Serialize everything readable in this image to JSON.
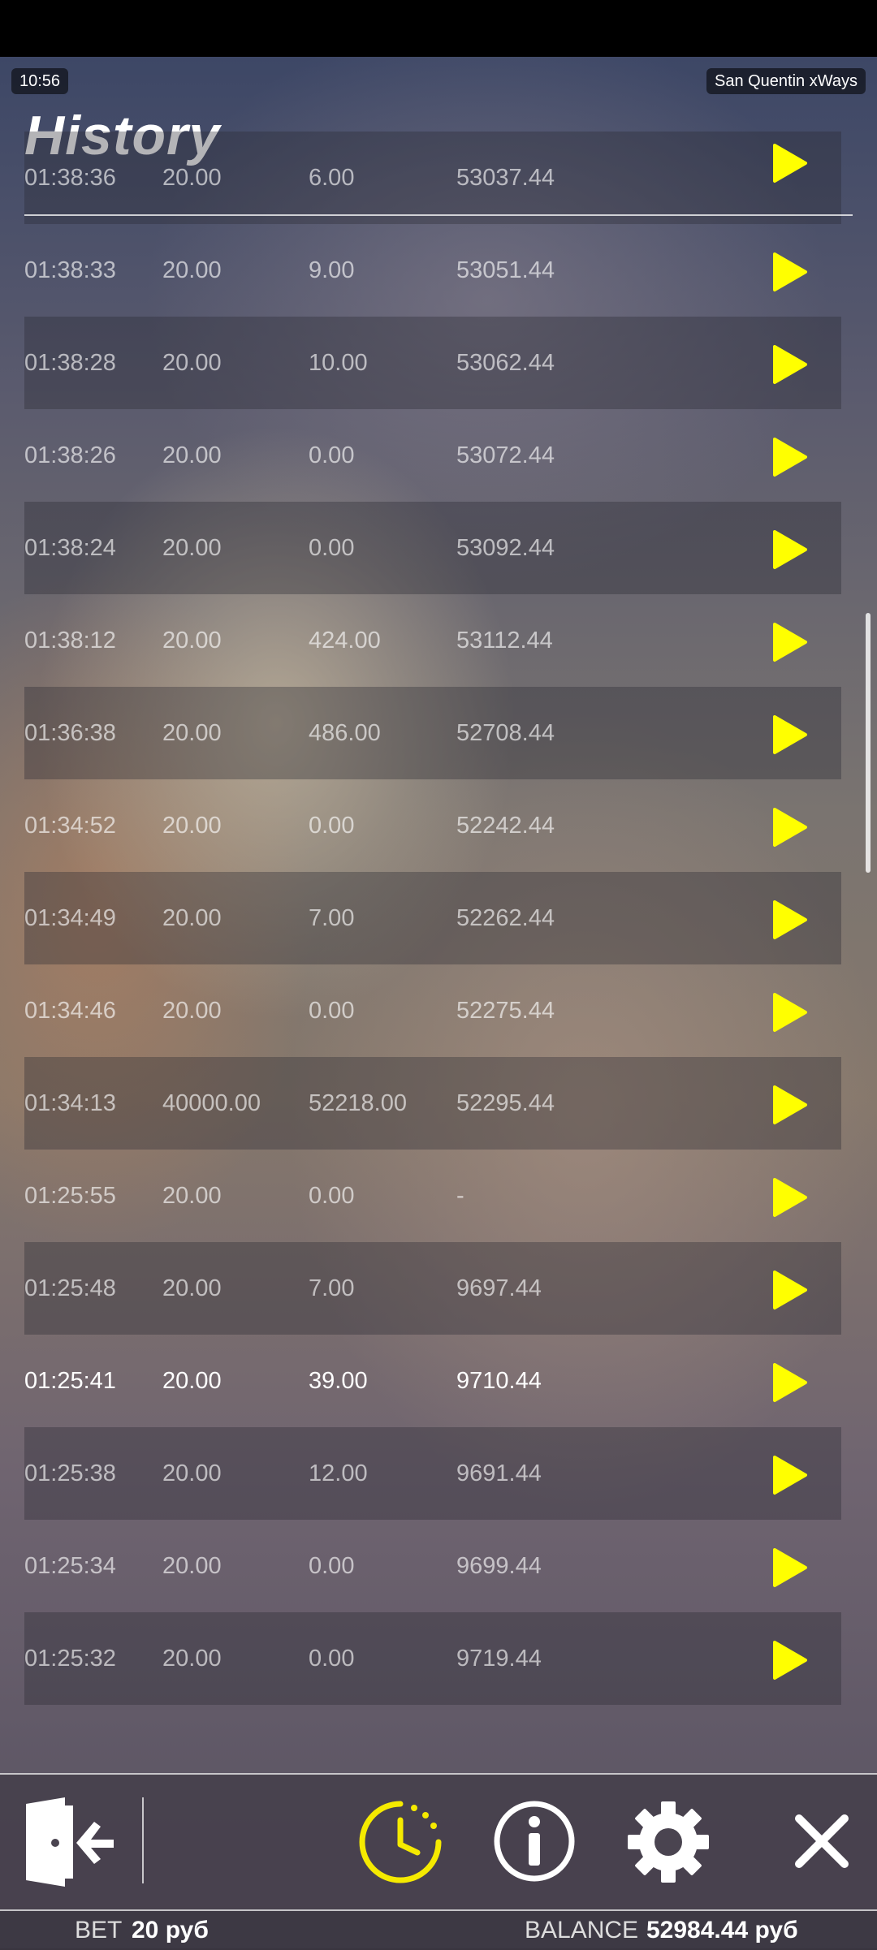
{
  "status_time": "10:56",
  "game_name": "San Quentin xWays",
  "page_title": "History",
  "rows": [
    {
      "time": "01:38:36",
      "bet": "20.00",
      "win": "6.00",
      "balance": "53037.44"
    },
    {
      "time": "01:38:33",
      "bet": "20.00",
      "win": "9.00",
      "balance": "53051.44"
    },
    {
      "time": "01:38:28",
      "bet": "20.00",
      "win": "10.00",
      "balance": "53062.44"
    },
    {
      "time": "01:38:26",
      "bet": "20.00",
      "win": "0.00",
      "balance": "53072.44"
    },
    {
      "time": "01:38:24",
      "bet": "20.00",
      "win": "0.00",
      "balance": "53092.44"
    },
    {
      "time": "01:38:12",
      "bet": "20.00",
      "win": "424.00",
      "balance": "53112.44"
    },
    {
      "time": "01:36:38",
      "bet": "20.00",
      "win": "486.00",
      "balance": "52708.44"
    },
    {
      "time": "01:34:52",
      "bet": "20.00",
      "win": "0.00",
      "balance": "52242.44"
    },
    {
      "time": "01:34:49",
      "bet": "20.00",
      "win": "7.00",
      "balance": "52262.44"
    },
    {
      "time": "01:34:46",
      "bet": "20.00",
      "win": "0.00",
      "balance": "52275.44"
    },
    {
      "time": "01:34:13",
      "bet": "40000.00",
      "win": "52218.00",
      "balance": "52295.44"
    },
    {
      "time": "01:25:55",
      "bet": "20.00",
      "win": "0.00",
      "balance": "-"
    },
    {
      "time": "01:25:48",
      "bet": "20.00",
      "win": "7.00",
      "balance": "9697.44"
    },
    {
      "time": "01:25:41",
      "bet": "20.00",
      "win": "39.00",
      "balance": "9710.44"
    },
    {
      "time": "01:25:38",
      "bet": "20.00",
      "win": "12.00",
      "balance": "9691.44"
    },
    {
      "time": "01:25:34",
      "bet": "20.00",
      "win": "0.00",
      "balance": "9699.44"
    },
    {
      "time": "01:25:32",
      "bet": "20.00",
      "win": "0.00",
      "balance": "9719.44"
    }
  ],
  "footer": {
    "bet_label": "BET",
    "bet_value": "20 руб",
    "balance_label": "BALANCE",
    "balance_value": "52984.44 руб"
  },
  "colors": {
    "accent": "#f5ea00",
    "play_icon": "#ffff00"
  },
  "icons": {
    "row_action": "play-icon",
    "toolbar": [
      "exit-door-icon",
      "history-clock-icon",
      "info-icon",
      "settings-gear-icon",
      "close-icon"
    ]
  }
}
